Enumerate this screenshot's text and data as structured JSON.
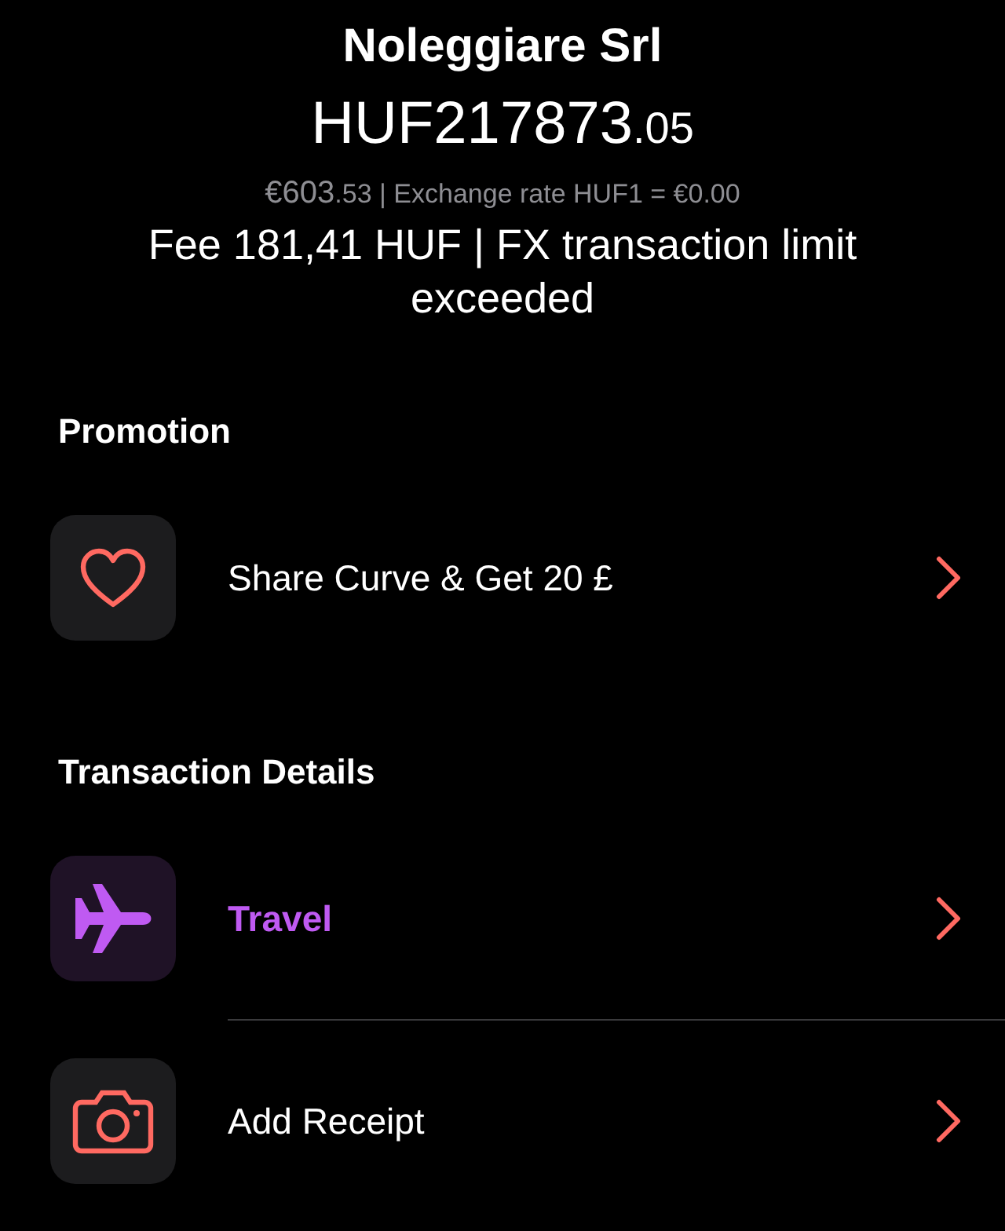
{
  "merchant": "Noleggiare Srl",
  "amount": {
    "whole": "HUF217873",
    "decimals": ".05"
  },
  "exchange": {
    "whole": "€603",
    "rest": ".53 | Exchange rate HUF1 = €0.00"
  },
  "fee_note": "Fee 181,41 HUF | FX transaction limit exceeded",
  "sections": [
    {
      "title": "Promotion",
      "items": [
        {
          "kind": "heart",
          "label": "Share Curve & Get 20 £",
          "color": "#ffffff"
        }
      ]
    },
    {
      "title": "Transaction Details",
      "items": [
        {
          "kind": "plane",
          "label": "Travel",
          "color": "#bf5af2"
        },
        {
          "kind": "camera",
          "label": "Add Receipt",
          "color": "#ffffff"
        }
      ]
    }
  ]
}
